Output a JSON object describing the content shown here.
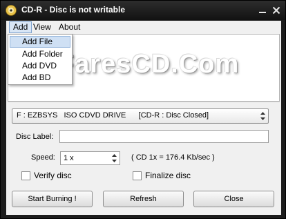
{
  "window": {
    "title": "CD-R - Disc is not writable"
  },
  "menubar": {
    "items": [
      "Add",
      "View",
      "About"
    ]
  },
  "add_menu": {
    "items": [
      "Add File",
      "Add Folder",
      "Add DVD",
      "Add BD"
    ]
  },
  "watermark": "FaresCD.Com",
  "drive": {
    "selected": "F : EZBSYS   ISO CDVD DRIVE      [CD-R : Disc Closed]"
  },
  "disc_label": {
    "label": "Disc Label:",
    "value": ""
  },
  "speed": {
    "label": "Speed:",
    "value": "1 x",
    "info": "( CD 1x = 176.4 Kb/sec )"
  },
  "options": {
    "verify": "Verify disc",
    "finalize": "Finalize disc",
    "verify_checked": false,
    "finalize_checked": false
  },
  "buttons": {
    "start": "Start Burning !",
    "refresh": "Refresh",
    "close": "Close"
  }
}
